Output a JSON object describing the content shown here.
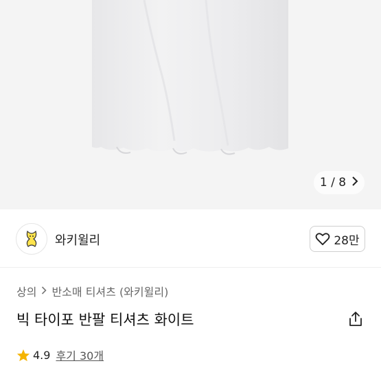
{
  "gallery": {
    "pager_text": "1 / 8",
    "current_index": 1,
    "total_images": 8
  },
  "brand": {
    "name": "와키윌리",
    "logo_icon": "yellow-character-logo",
    "like_count": "28만"
  },
  "breadcrumb": {
    "items": [
      "상의",
      "반소매 티셔츠 (와키윌리)"
    ]
  },
  "product": {
    "title": "빅 타이포 반팔 티셔츠 화이트"
  },
  "rating": {
    "score": "4.9",
    "reviews_label": "후기 30개",
    "star_color": "#f5b400"
  },
  "icons": {
    "share": "share-icon",
    "heart": "heart-outline-icon",
    "chevron": "chevron-right-icon"
  }
}
